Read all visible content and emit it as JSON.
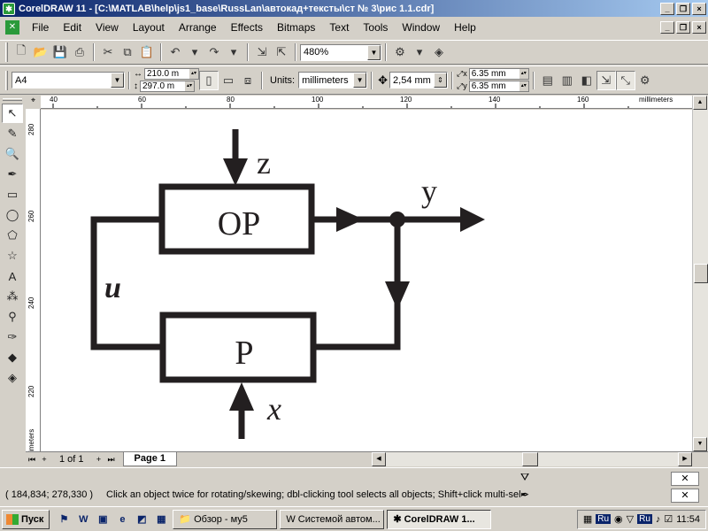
{
  "window": {
    "title": "CorelDRAW 11 - [C:\\MATLAB\\help\\js1_base\\RussLan\\автокад+тексты\\ст № 3\\рис 1.1.cdr]",
    "controls": [
      "_",
      "❐",
      "×"
    ]
  },
  "menu": {
    "items": [
      "File",
      "Edit",
      "View",
      "Layout",
      "Arrange",
      "Effects",
      "Bitmaps",
      "Text",
      "Tools",
      "Window",
      "Help"
    ]
  },
  "standard_toolbar": {
    "zoom": "480%"
  },
  "property_bar": {
    "paper": "A4",
    "width": "210.0 m",
    "height": "297.0 m",
    "units_label": "Units:",
    "units": "millimeters",
    "nudge": "2,54 mm",
    "dup_x": "6.35 mm",
    "dup_y": "6.35 mm"
  },
  "ruler": {
    "unit_label": "millimeters",
    "h_ticks": [
      "40",
      "60",
      "80",
      "100",
      "120",
      "140",
      "160"
    ],
    "v_ticks": [
      "280",
      "260",
      "240",
      "220"
    ]
  },
  "drawing": {
    "block_top": "OP",
    "block_bottom": "P",
    "label_z": "z",
    "label_y": "y",
    "label_u": "u",
    "label_x": "x"
  },
  "page_nav": {
    "count": "1 of 1",
    "tab": "Page 1"
  },
  "status": {
    "coords": "( 184,834; 278,330 )",
    "message": "Click an object twice for rotating/skewing; dbl-clicking tool selects all objects; Shift+click multi-sele...",
    "fill": "✕",
    "outline": "✕"
  },
  "taskbar": {
    "start": "Пуск",
    "tasks": [
      "Обзор - му5",
      "Системой автом...",
      "CorelDRAW 1..."
    ],
    "lang": "Ru",
    "clock": "11:54"
  },
  "colors": {
    "title_start": "#0a246a",
    "title_end": "#a6caf0",
    "face": "#d4d0c8",
    "ink": "#231f20"
  }
}
